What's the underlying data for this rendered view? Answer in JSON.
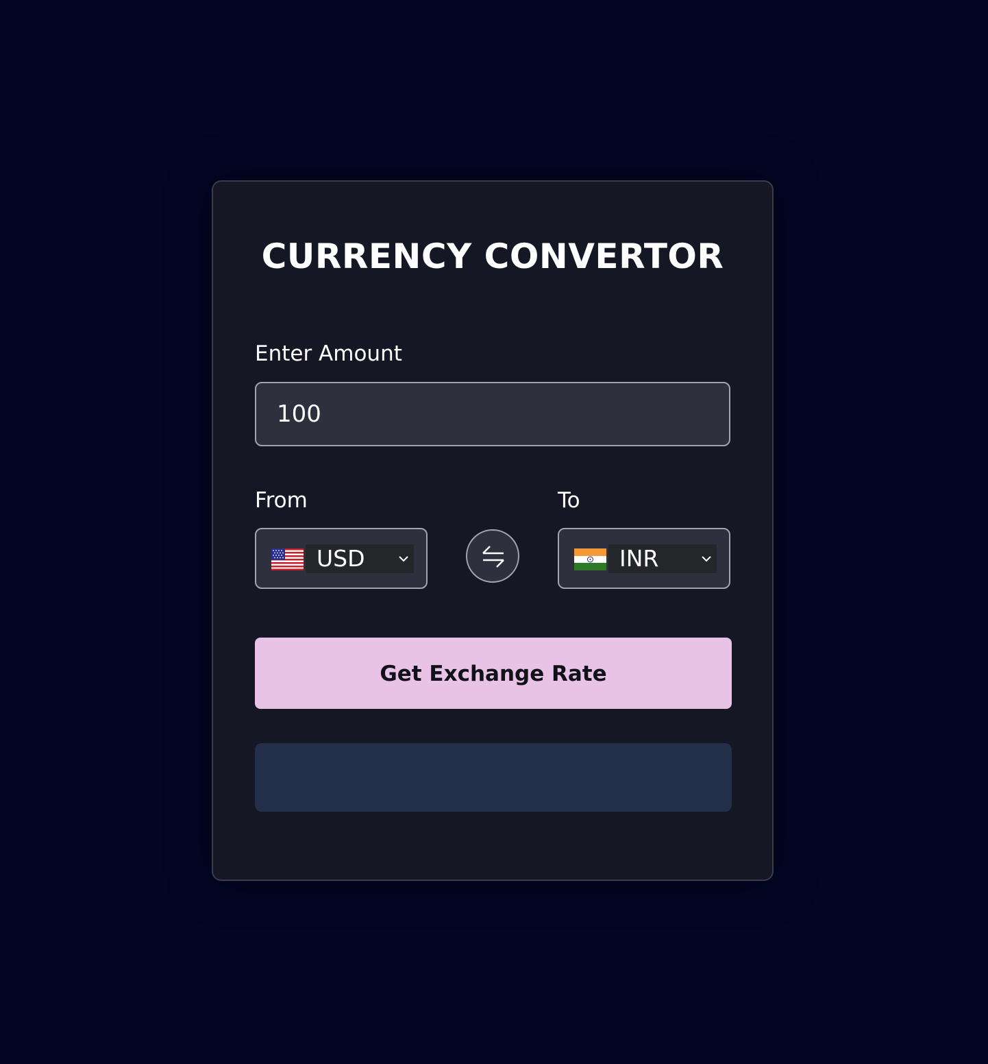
{
  "app": {
    "title": "CURRENCY CONVERTOR"
  },
  "amount": {
    "label": "Enter Amount",
    "value": "100"
  },
  "from": {
    "label": "From",
    "currency": "USD",
    "flag_icon": "us-flag-icon"
  },
  "to": {
    "label": "To",
    "currency": "INR",
    "flag_icon": "india-flag-icon"
  },
  "swap": {
    "icon": "swap-arrows-icon"
  },
  "action": {
    "button_label": "Get Exchange Rate"
  },
  "result": {
    "text": ""
  },
  "colors": {
    "background": "#020625",
    "card": "#161725",
    "input": "#2e303d",
    "button": "#e9c3e5",
    "result": "#232e48"
  }
}
